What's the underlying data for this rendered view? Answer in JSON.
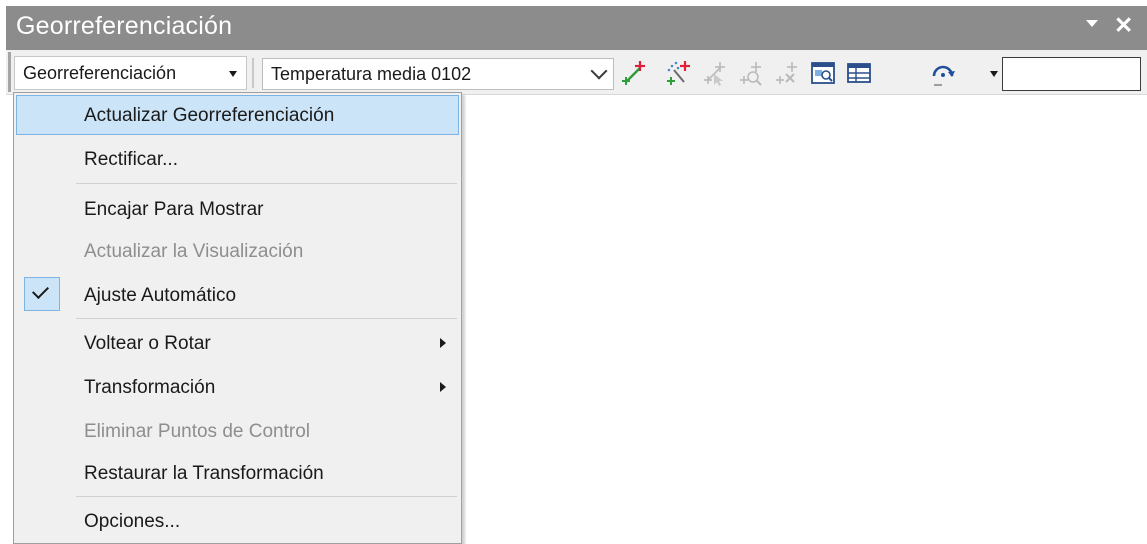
{
  "window": {
    "title": "Georreferenciación"
  },
  "toolbar": {
    "menu_label": "Georreferenciación",
    "layer_value": "Temperatura media 0102",
    "input_value": "",
    "tools": [
      {
        "icon": "add-control-points-icon",
        "enabled": true
      },
      {
        "icon": "auto-registration-icon",
        "enabled": true
      },
      {
        "icon": "select-link-icon",
        "enabled": false
      },
      {
        "icon": "zoom-to-selected-link-icon",
        "enabled": false
      },
      {
        "icon": "delete-link-icon",
        "enabled": false
      },
      {
        "icon": "viewer-icon",
        "enabled": true
      },
      {
        "icon": "link-table-icon",
        "enabled": true
      },
      {
        "icon": "rotate-icon",
        "enabled": true
      }
    ]
  },
  "menu": {
    "items": [
      {
        "label": "Actualizar Georreferenciación",
        "enabled": true,
        "highlighted": true
      },
      {
        "label": "Rectificar...",
        "enabled": true
      },
      {
        "label": "Encajar Para Mostrar",
        "enabled": true
      },
      {
        "label": "Actualizar la Visualización",
        "enabled": false
      },
      {
        "label": "Ajuste  Automático",
        "enabled": true,
        "checked": true
      },
      {
        "label": "Voltear o Rotar",
        "enabled": true,
        "submenu": true
      },
      {
        "label": "Transformación",
        "enabled": true,
        "submenu": true
      },
      {
        "label": "Eliminar Puntos de Control",
        "enabled": false
      },
      {
        "label": "Restaurar la Transformación",
        "enabled": true
      },
      {
        "label": "Opciones...",
        "enabled": true
      }
    ]
  },
  "colors": {
    "titlebar": "#8c8c8c",
    "highlight_fill": "#cce4f7",
    "highlight_border": "#7eb4e4",
    "disabled_text": "#8e8e8e",
    "add_point_green": "#2e9e3a",
    "add_point_red": "#e0203a"
  }
}
